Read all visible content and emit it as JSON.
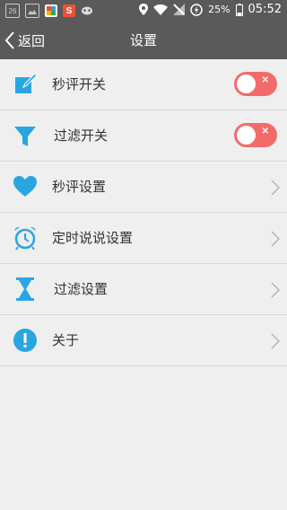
{
  "status_bar": {
    "date_icon": "26",
    "battery": "25%",
    "time": "05:52"
  },
  "header": {
    "back_label": "返回",
    "title": "设置"
  },
  "colors": {
    "accent": "#29a6e2",
    "toggle_off": "#f26b6b",
    "bar": "#5a5a5a"
  },
  "rows": [
    {
      "label": "秒评开关",
      "icon": "edit-icon",
      "control": "toggle"
    },
    {
      "label": "过滤开关",
      "icon": "filter-icon",
      "control": "toggle"
    },
    {
      "label": "秒评设置",
      "icon": "heart-icon",
      "control": "chevron"
    },
    {
      "label": "定时说说设置",
      "icon": "alarm-clock-icon",
      "control": "chevron"
    },
    {
      "label": "过滤设置",
      "icon": "hourglass-icon",
      "control": "chevron"
    },
    {
      "label": "关于",
      "icon": "info-icon",
      "control": "chevron"
    }
  ]
}
